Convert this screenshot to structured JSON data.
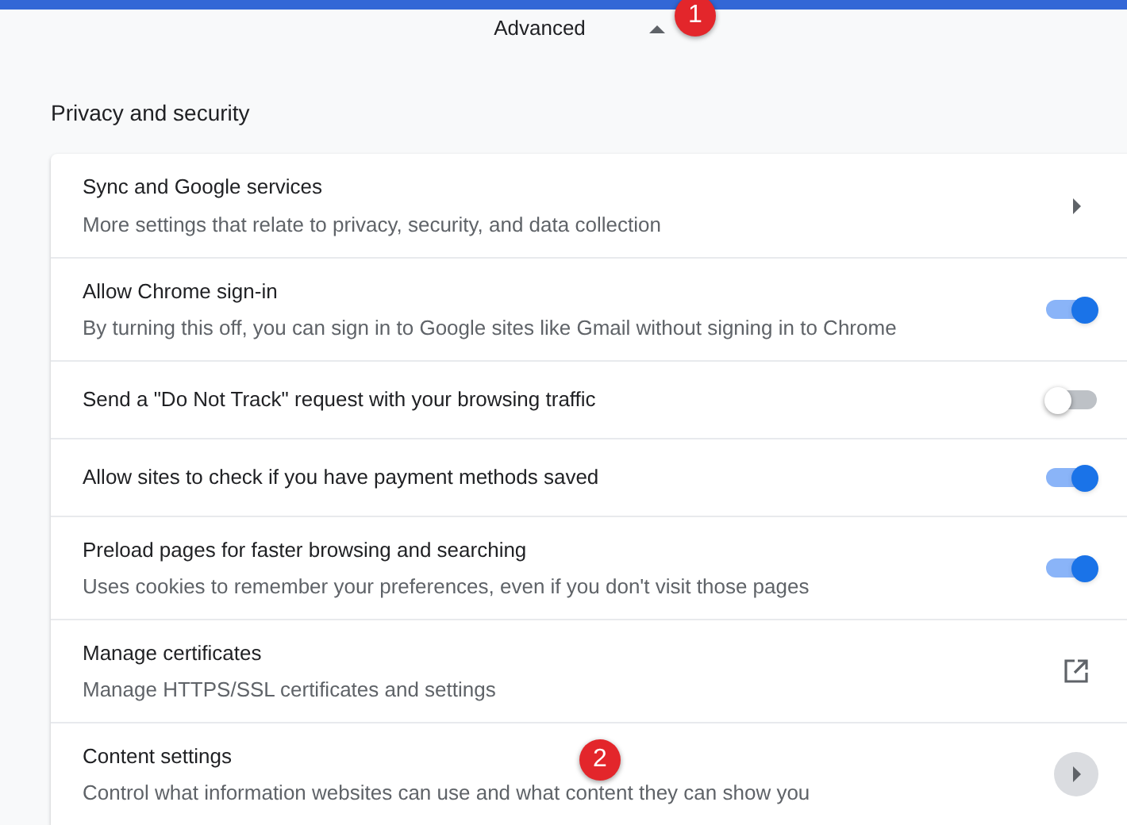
{
  "advanced": {
    "label": "Advanced",
    "expanded": true
  },
  "section_title": "Privacy and security",
  "rows": [
    {
      "kind": "arrow",
      "title": "Sync and Google services",
      "subtitle": "More settings that relate to privacy, security, and data collection",
      "hovered": false
    },
    {
      "kind": "toggle",
      "title": "Allow Chrome sign-in",
      "subtitle": "By turning this off, you can sign in to Google sites like Gmail without signing in to Chrome",
      "on": true
    },
    {
      "kind": "toggle",
      "title": "Send a \"Do Not Track\" request with your browsing traffic",
      "on": false
    },
    {
      "kind": "toggle",
      "title": "Allow sites to check if you have payment methods saved",
      "on": true
    },
    {
      "kind": "toggle",
      "title": "Preload pages for faster browsing and searching",
      "subtitle": "Uses cookies to remember your preferences, even if you don't visit those pages",
      "on": true
    },
    {
      "kind": "external",
      "title": "Manage certificates",
      "subtitle": "Manage HTTPS/SSL certificates and settings"
    },
    {
      "kind": "arrow",
      "title": "Content settings",
      "subtitle": "Control what information websites can use and what content they can show you",
      "hovered": true
    }
  ],
  "badges": [
    {
      "text": "1"
    },
    {
      "text": "2"
    }
  ]
}
